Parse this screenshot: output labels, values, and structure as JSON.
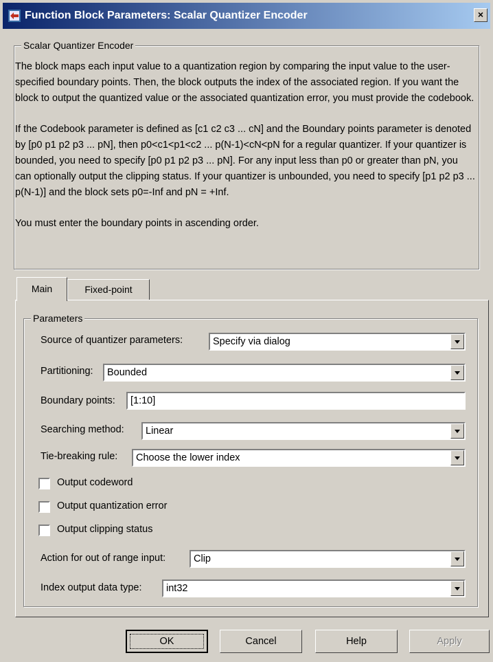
{
  "window": {
    "title": "Function Block Parameters: Scalar Quantizer Encoder",
    "close_glyph": "×",
    "icon": "simulink-block-icon"
  },
  "description": {
    "group_title": "Scalar Quantizer Encoder",
    "paragraph1": "The block maps each input value to a quantization region by comparing the input value to the user-specified boundary points. Then, the block outputs the index of the associated region. If you want the block to output the quantized value or the associated quantization error, you must provide the codebook.",
    "paragraph2": "If the Codebook parameter is defined as [c1 c2 c3 ... cN] and the Boundary points parameter is denoted by [p0 p1 p2 p3 ... pN], then p0<c1<p1<c2 ... p(N-1)<cN<pN for a regular quantizer. If your quantizer is bounded, you need to specify [p0 p1 p2 p3 ... pN]. For any input less than p0 or greater than pN, you can optionally output the clipping status. If your quantizer is unbounded, you need to specify [p1 p2 p3 ... p(N-1)] and the block sets p0=-Inf and pN = +Inf.",
    "paragraph3": "You must enter the boundary points in ascending order."
  },
  "tabs": [
    {
      "label": "Main",
      "selected": true
    },
    {
      "label": "Fixed-point",
      "selected": false
    }
  ],
  "parameters": {
    "group_title": "Parameters",
    "source_label": "Source of quantizer parameters:",
    "source_value": "Specify via dialog",
    "partitioning_label": "Partitioning:",
    "partitioning_value": "Bounded",
    "boundary_label": "Boundary points:",
    "boundary_value": "[1:10]",
    "searching_label": "Searching method:",
    "searching_value": "Linear",
    "tiebreak_label": "Tie-breaking rule:",
    "tiebreak_value": "Choose the lower index",
    "output_codeword_label": "Output codeword",
    "output_codeword_checked": false,
    "output_qerror_label": "Output quantization error",
    "output_qerror_checked": false,
    "output_clipping_label": "Output clipping status",
    "output_clipping_checked": false,
    "action_label": "Action for out of range input:",
    "action_value": "Clip",
    "index_type_label": "Index output data type:",
    "index_type_value": "int32"
  },
  "buttons": {
    "ok": "OK",
    "cancel": "Cancel",
    "help": "Help",
    "apply": "Apply"
  },
  "colors": {
    "titlebar_start": "#0a246a",
    "titlebar_end": "#a6caf0",
    "face": "#d4d0c8"
  }
}
